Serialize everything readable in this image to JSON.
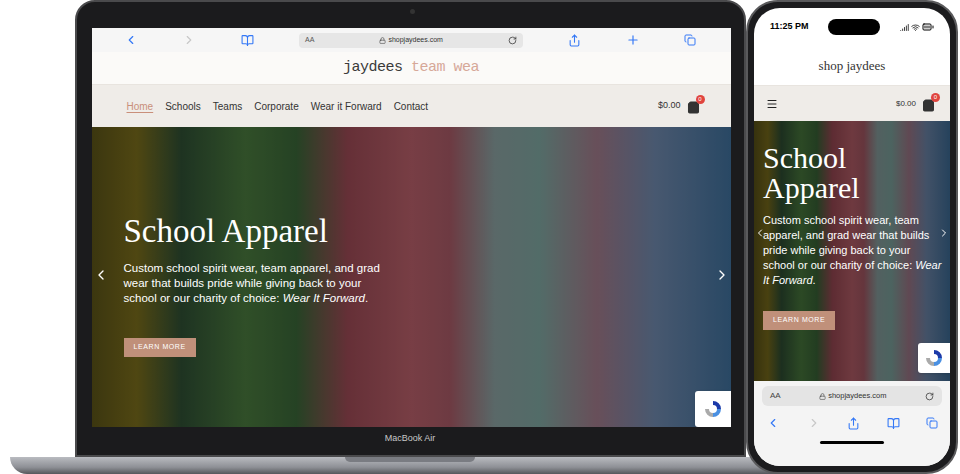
{
  "laptop": {
    "model": "MacBook Air",
    "browser": {
      "text_size": "AA",
      "address": "shopjaydees.com",
      "back_enabled": true,
      "forward_enabled": false
    },
    "site": {
      "logo": {
        "name": "jaydees",
        "tagline": "team wea"
      },
      "nav": [
        {
          "label": "Home",
          "selected": true
        },
        {
          "label": "Schools",
          "selected": false
        },
        {
          "label": "Teams",
          "selected": false
        },
        {
          "label": "Corporate",
          "selected": false
        },
        {
          "label": "Wear it Forward",
          "selected": false
        },
        {
          "label": "Contact",
          "selected": false
        }
      ],
      "cart": {
        "total": "$0.00",
        "count": "0"
      },
      "hero": {
        "title": "School Apparel",
        "body": "Custom school spirit wear, team apparel, and grad wear that builds pride while giving back to your school or our charity of choice: ",
        "emphasis": "Wear It Forward",
        "body_end": ".",
        "button": "LEARN MORE"
      }
    }
  },
  "phone": {
    "time": "11:25 PM",
    "site": {
      "logo": "shop jaydees",
      "cart": {
        "total": "$0.00",
        "count": "0"
      },
      "hero": {
        "title": "School Apparel",
        "body": "Custom school spirit wear, team apparel, and grad wear that builds pride while giving back to your school or our charity of choice: ",
        "emphasis": "Wear It Forward",
        "body_end": ".",
        "button": "LEARN MORE"
      }
    },
    "browser": {
      "text_size": "AA",
      "address": "shopjaydees.com",
      "back_enabled": true,
      "forward_enabled": false
    }
  }
}
